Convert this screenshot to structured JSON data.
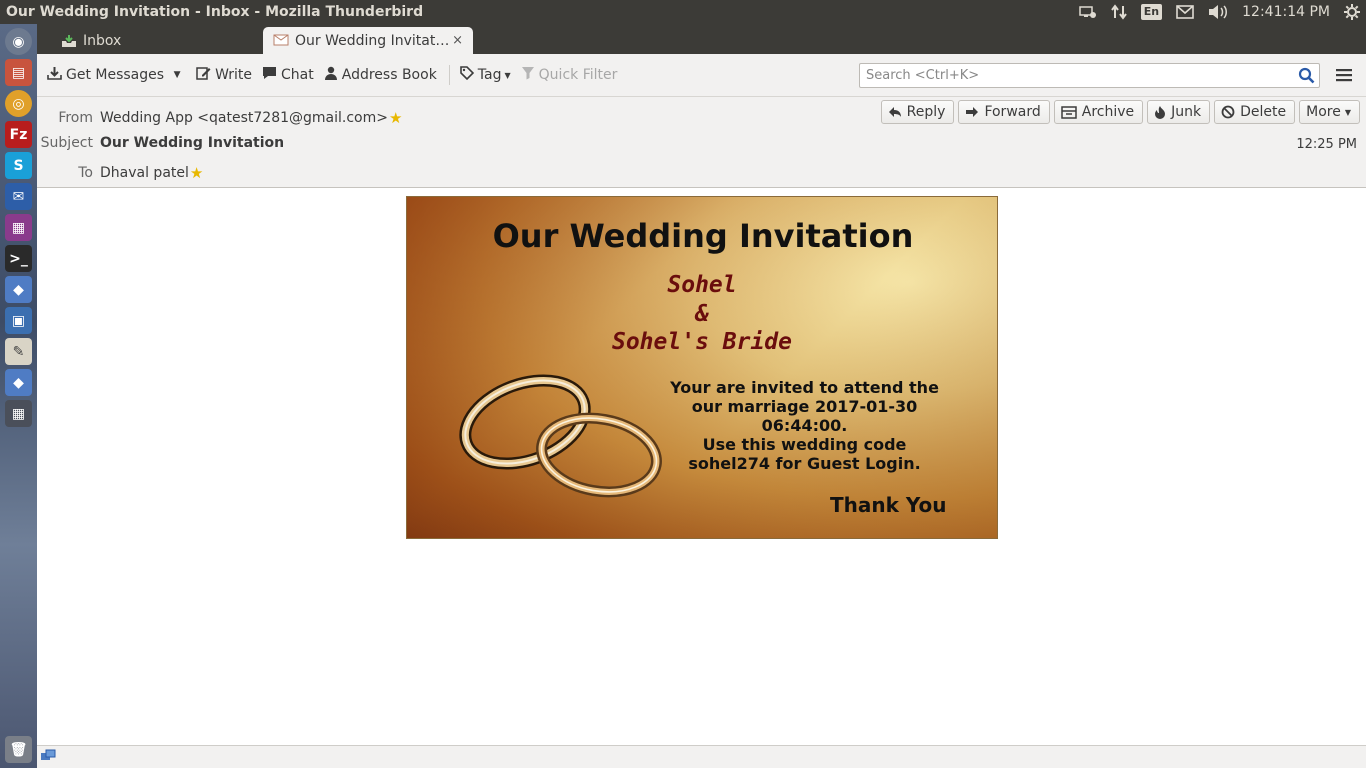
{
  "window": {
    "title": "Our Wedding Invitation - Inbox - Mozilla Thunderbird"
  },
  "system": {
    "keyboard": "En",
    "time": "12:41:14 PM"
  },
  "tabs": [
    {
      "label": "Inbox",
      "icon": "inbox-icon"
    },
    {
      "label": "Our Wedding Invitat…",
      "icon": "envelope-icon",
      "close": "×"
    }
  ],
  "toolbar": {
    "get_messages": "Get Messages",
    "write": "Write",
    "chat": "Chat",
    "address_book": "Address Book",
    "tag": "Tag",
    "quick_filter": "Quick Filter",
    "search_placeholder": "Search <Ctrl+K>"
  },
  "header": {
    "from_label": "From",
    "from_value": "Wedding App <qatest7281@gmail.com>",
    "subject_label": "Subject",
    "subject_value": "Our Wedding Invitation",
    "to_label": "To",
    "to_value": "Dhaval patel",
    "time": "12:25 PM",
    "buttons": {
      "reply": "Reply",
      "forward": "Forward",
      "archive": "Archive",
      "junk": "Junk",
      "delete": "Delete",
      "more": "More"
    }
  },
  "invitation": {
    "title": "Our Wedding Invitation",
    "groom": "Sohel",
    "amp": "&",
    "bride": "Sohel's Bride",
    "message_lines": [
      "Your are invited to attend the",
      "our marriage 2017-01-30",
      "06:44:00.",
      "Use this wedding code",
      "sohel274 for Guest Login."
    ],
    "thanks": "Thank You"
  },
  "colors": {
    "panel": "#3c3b37",
    "accent_star": "#e8b800",
    "name_red": "#6a0d0d"
  }
}
